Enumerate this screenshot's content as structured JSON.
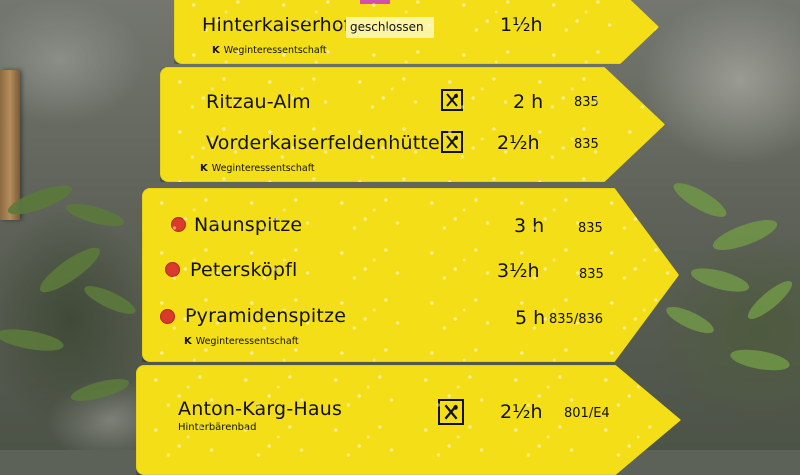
{
  "signs": [
    {
      "rows": [
        {
          "destination": "Hinterkaiserhof",
          "note": "geschlossen",
          "time": "1½h",
          "route": ""
        }
      ],
      "association": "Weginteressentschaft"
    },
    {
      "rows": [
        {
          "destination": "Ritzau-Alm",
          "icon": "restaurant-icon",
          "time": "2 h",
          "route": "835"
        },
        {
          "destination": "Vorderkaiserfeldenhütte",
          "icon": "restaurant-icon",
          "time": "2½h",
          "route": "835"
        }
      ],
      "association": "Weginteressentschaft"
    },
    {
      "rows": [
        {
          "destination": "Naunspitze",
          "icon": "summit-dot-icon",
          "time": "3 h",
          "route": "835"
        },
        {
          "destination": "Petersköpfl",
          "icon": "summit-dot-icon",
          "time": "3½h",
          "route": "835"
        },
        {
          "destination": "Pyramidenspitze",
          "icon": "summit-dot-icon",
          "time": "5 h",
          "route": "835/836"
        }
      ],
      "association": "Weginteressentschaft"
    },
    {
      "rows": [
        {
          "destination": "Anton-Karg-Haus",
          "subtitle": "Hinterbärenbad",
          "icon": "restaurant-icon",
          "time": "2½h",
          "route": "801/E4"
        }
      ]
    }
  ],
  "colors": {
    "sign_yellow": "#f4de18",
    "summit_red": "#d93a2a",
    "text": "#111111",
    "sticker_magenta": "#d14fb0"
  },
  "association_logo_letter": "K"
}
